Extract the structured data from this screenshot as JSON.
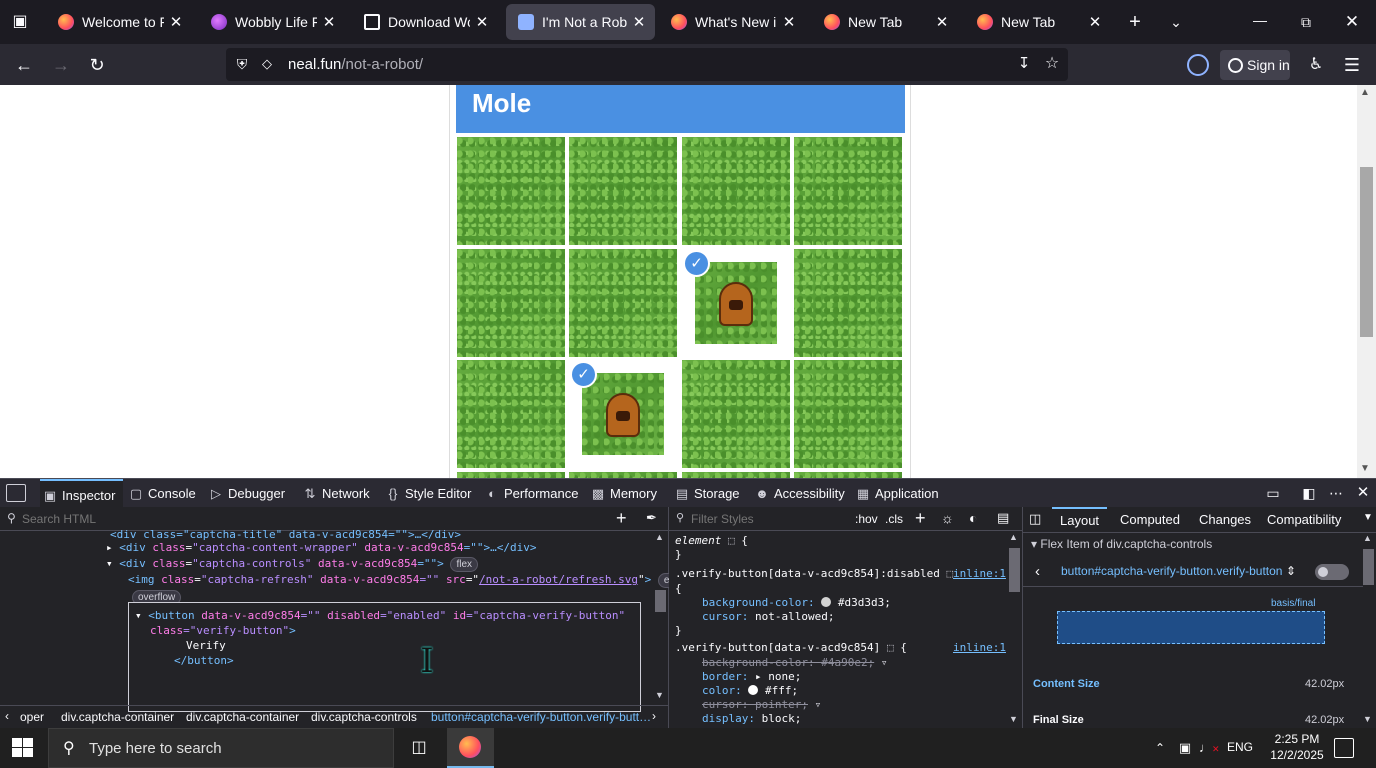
{
  "browser": {
    "tabs": [
      {
        "title": "Welcome to Firefox",
        "icon": "firefox-icon",
        "active": false
      },
      {
        "title": "Wobbly Life Free Download",
        "icon": "wobbly-icon",
        "active": false
      },
      {
        "title": "Download Wobbly Life",
        "icon": "cube-icon",
        "active": false
      },
      {
        "title": "I'm Not a Robot",
        "icon": "robot-icon",
        "active": true
      },
      {
        "title": "What's New in Firefox",
        "icon": "firefox-icon",
        "active": false
      },
      {
        "title": "New Tab",
        "icon": "firefox-icon",
        "active": false
      },
      {
        "title": "New Tab",
        "icon": "firefox-icon",
        "active": false
      }
    ],
    "url_domain": "neal.fun",
    "url_path": "/not-a-robot/",
    "sign_in_label": "Sign in"
  },
  "page": {
    "captcha_title": "Mole",
    "grid": [
      [
        false,
        false,
        false,
        false
      ],
      [
        false,
        false,
        true,
        false
      ],
      [
        false,
        true,
        false,
        false
      ]
    ]
  },
  "devtools": {
    "tabs": [
      "Inspector",
      "Console",
      "Debugger",
      "Network",
      "Style Editor",
      "Performance",
      "Memory",
      "Storage",
      "Accessibility",
      "Application"
    ],
    "search_placeholder": "Search HTML",
    "filter_placeholder": "Filter Styles",
    "hov_label": ":hov",
    "cls_label": ".cls",
    "html_lines": {
      "l0": "<div class=\"captcha-title\" data-v-acd9c854=\"\">…</div>",
      "l1_tag": "<div",
      "l1_attr": "class",
      "l1_val": "\"captcha-content-wrapper\"",
      "l1_attr2": "data-v-acd9c854",
      "l1_rest": "=\"\">",
      "l1_end": "…</div>",
      "l2_tag": "<div",
      "l2_attr": "class",
      "l2_val": "\"captcha-controls\"",
      "l2_attr2": "data-v-acd9c854",
      "l2_rest": "=\"\">",
      "l2_badge": "flex",
      "l3_tag": "<img",
      "l3_attr": "class",
      "l3_val": "\"captcha-refresh\"",
      "l3_attr2": "data-v-acd9c854",
      "l3_eq": "=\"\"",
      "l3_attr3": "src",
      "l3_link": "/not-a-robot/refresh.svg",
      "l3_close": ">",
      "l3_badge": "event",
      "overflow_badge": "overflow",
      "l4_tag": "<button",
      "l4_attr": "data-v-acd9c854",
      "l4_eq": "=\"\"",
      "l4_attr2": "disabled",
      "l4_val2": "=\"enabled\"",
      "l4_attr3": "id",
      "l4_val3": "=\"captcha-verify-button\"",
      "l5_attr": "class",
      "l5_val": "=\"verify-button\"",
      "l5_close": ">",
      "l6_text": "Verify",
      "l7_close": "</button>"
    },
    "breadcrumbs": [
      "oper",
      "div.captcha-container",
      "div.captcha-container",
      "div.captcha-controls",
      "button#captcha-verify-button.verify-butt…"
    ],
    "rules": {
      "r0_sel": "element",
      "r0_brace": "{",
      "r0_close": "}",
      "r1_sel": ".verify-button[data-v-acd9c854]:disabled",
      "r1_src": "inline:1",
      "r1_open": "{",
      "r1_p1": "background-color:",
      "r1_v1": "#d3d3d3;",
      "r1_p2": "cursor:",
      "r1_v2": "not-allowed;",
      "r1_close": "}",
      "r2_sel": ".verify-button[data-v-acd9c854]",
      "r2_src": "inline:1",
      "r2_open": "{",
      "r2_p1": "background-color: #4a90e2;",
      "r2_p2": "border:",
      "r2_v2": "none;",
      "r2_p3": "color:",
      "r2_v3": "#fff;",
      "r2_p4": "cursor: pointer;",
      "r2_p5": "display:",
      "r2_v5": "block;"
    },
    "layout_tabs": [
      "Layout",
      "Computed",
      "Changes",
      "Compatibility"
    ],
    "flex_item_header": "Flex Item of div.captcha-controls",
    "flex_item_selector": "button#captcha-verify-button.verify-button",
    "basis_label": "basis/final",
    "content_size_label": "Content Size",
    "content_size_value": "42.02px",
    "final_size_label": "Final Size",
    "final_size_value": "42.02px"
  },
  "taskbar": {
    "search_placeholder": "Type here to search",
    "lang": "ENG",
    "time": "2:25 PM",
    "date": "12/2/2025"
  },
  "colors": {
    "accent": "#4a90e2",
    "disabled_bg": "#d3d3d3",
    "devtools_bg": "#232327"
  }
}
